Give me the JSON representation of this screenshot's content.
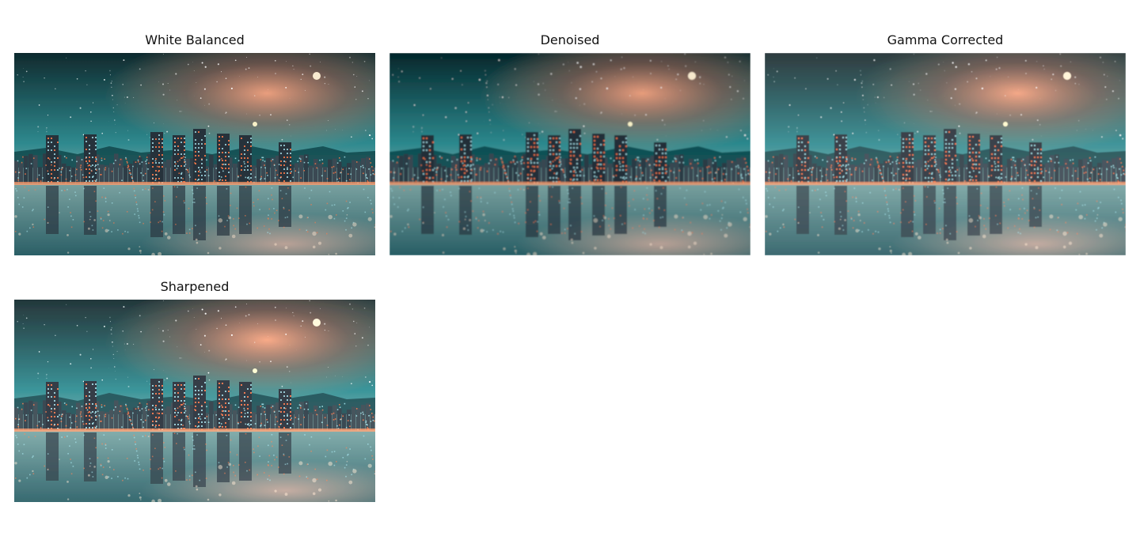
{
  "panels": [
    {
      "title": "White Balanced"
    },
    {
      "title": "Denoised"
    },
    {
      "title": "Gamma Corrected"
    },
    {
      "title": "Sharpened"
    }
  ],
  "colors": {
    "sky_dark": "#0f2a2e",
    "sky_teal": "#2f8a8f",
    "galaxy_glow": "#f4a27f",
    "water": "#2b5f66",
    "city_lights": "#ff7a4a"
  }
}
